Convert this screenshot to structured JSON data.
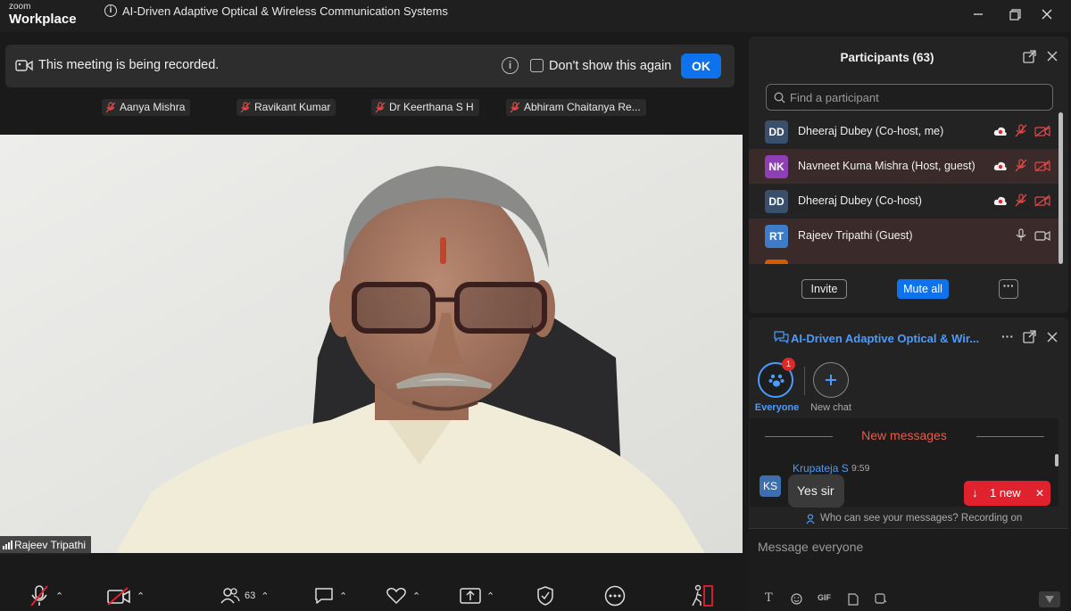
{
  "titlebar": {
    "brand_top": "zoom",
    "brand_bottom": "Workplace",
    "meeting_title": "AI-Driven Adaptive Optical  & Wireless Communication Systems"
  },
  "recording_banner": {
    "message": "This meeting is being recorded.",
    "dont_show": "Don't show this again",
    "ok": "OK"
  },
  "gallery": {
    "names": [
      "Aanya Mishra",
      "Ravikant Kumar",
      "Dr Keerthana S H",
      "Abhiram Chaitanya Re..."
    ]
  },
  "video": {
    "speaker_name": "Rajeev Tripathi"
  },
  "toolbar": {
    "participants_count": "63"
  },
  "participants": {
    "title": "Participants (63)",
    "search_placeholder": "Find a participant",
    "rows": [
      {
        "initials": "DD",
        "name": "Dheeraj Dubey (Co-host, me)",
        "color": "#3a4f6b"
      },
      {
        "initials": "NK",
        "name": "Navneet Kuma Mishra (Host, guest)",
        "color": "#8e3fb5"
      },
      {
        "initials": "DD",
        "name": "Dheeraj Dubey (Co-host)",
        "color": "#3a4f6b"
      },
      {
        "initials": "RT",
        "name": "Rajeev Tripathi (Guest)",
        "color": "#3d7cc9"
      }
    ],
    "invite": "Invite",
    "mute_all": "Mute all"
  },
  "chat": {
    "title": "AI-Driven Adaptive Optical  & Wir...",
    "everyone_label": "Everyone",
    "everyone_badge": "1",
    "new_chat_label": "New chat",
    "new_messages": "New messages",
    "message": {
      "sender": "Krupateja S",
      "time": "9:59",
      "initials": "KS",
      "text": "Yes sir"
    },
    "new_count": "1 new",
    "who_can_see": "Who can see your messages? Recording on",
    "composer_placeholder": "Message everyone"
  },
  "colors": {
    "accent": "#0e72ed",
    "link": "#4a9cff",
    "alert": "#e0222f"
  }
}
